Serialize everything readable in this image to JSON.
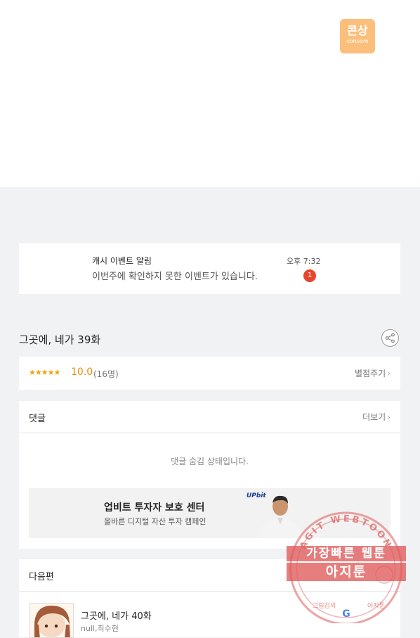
{
  "logo": {
    "main": "콘상",
    "sub": "consom"
  },
  "notification": {
    "title": "캐시 이벤트 알림",
    "message": "이번주에 확인하지 못한 이벤트가 있습니다.",
    "time": "오후 7:32",
    "count": "1"
  },
  "episode": {
    "title": "그곳에, 네가 39화"
  },
  "rating": {
    "stars": "★★★★★",
    "score": "10.0",
    "count": "(16명)",
    "rate_label": "별점주기"
  },
  "comments": {
    "title": "댓글",
    "more_label": "더보기",
    "hidden_message": "댓글 숨김 상태입니다."
  },
  "ad": {
    "title": "업비트 투자자 보호 센터",
    "subtitle": "올바른 디지털 자산 투자 캠페인",
    "logo": "UPbit"
  },
  "next_episode": {
    "section_title": "다음편",
    "title": "그곳에, 네가 40화",
    "author": "null,최수현"
  },
  "watermark": {
    "arc_text": "AGIT WEBTOON",
    "line1": "가장빠른 웹툰",
    "line2": "아지툰",
    "bottom_left": "그림검색",
    "bottom_right": "아지툰"
  },
  "colors": {
    "accent_orange": "#e88a0a",
    "badge_red": "#e8452c",
    "logo_orange": "#fbbf7c",
    "watermark_red": "#e05a5a"
  }
}
